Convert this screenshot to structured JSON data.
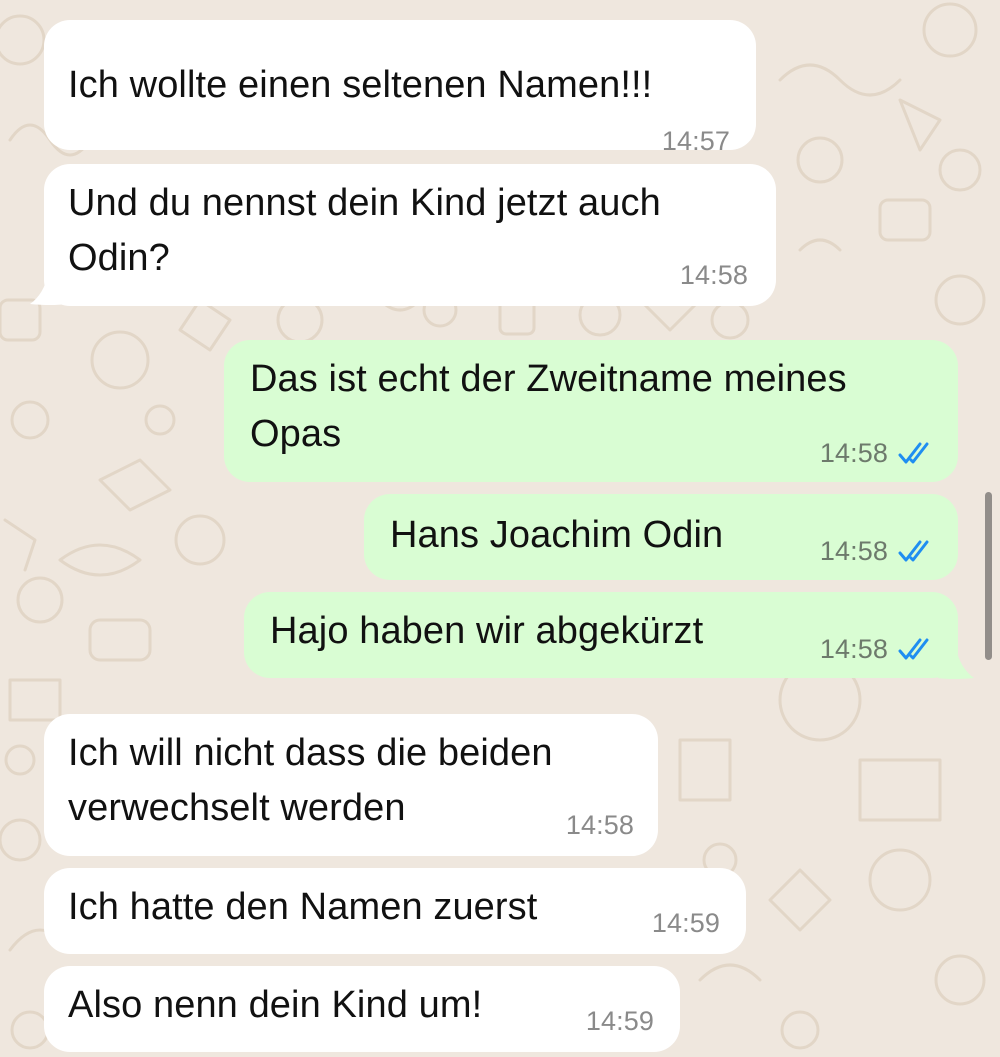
{
  "chat": {
    "messages": [
      {
        "direction": "incoming",
        "text": "Ich wollte einen seltenen Namen!!!",
        "time": "14:57"
      },
      {
        "direction": "incoming",
        "text": "Und du nennst dein Kind jetzt auch\nOdin?",
        "time": "14:58"
      },
      {
        "direction": "outgoing",
        "text": "Das ist echt der Zweitname meines\nOpas",
        "time": "14:58",
        "status": "read-double-check-icon"
      },
      {
        "direction": "outgoing",
        "text": "Hans Joachim Odin",
        "time": "14:58",
        "status": "read-double-check-icon"
      },
      {
        "direction": "outgoing",
        "text": "Hajo haben wir abgekürzt",
        "time": "14:58",
        "status": "read-double-check-icon"
      },
      {
        "direction": "incoming",
        "text": "Ich will nicht dass die beiden\nverwechselt werden",
        "time": "14:58"
      },
      {
        "direction": "incoming",
        "text": "Ich hatte den Namen zuerst",
        "time": "14:59"
      },
      {
        "direction": "incoming",
        "text": "Also nenn dein Kind um!",
        "time": "14:59"
      }
    ]
  },
  "colors": {
    "wallpaper": "#efe7de",
    "doodle_stroke": "#e2d6c7",
    "incoming_bubble": "#ffffff",
    "outgoing_bubble": "#d9fdd3",
    "read_ticks": "#1f8ef1",
    "timestamp": "#8a8a8a"
  }
}
